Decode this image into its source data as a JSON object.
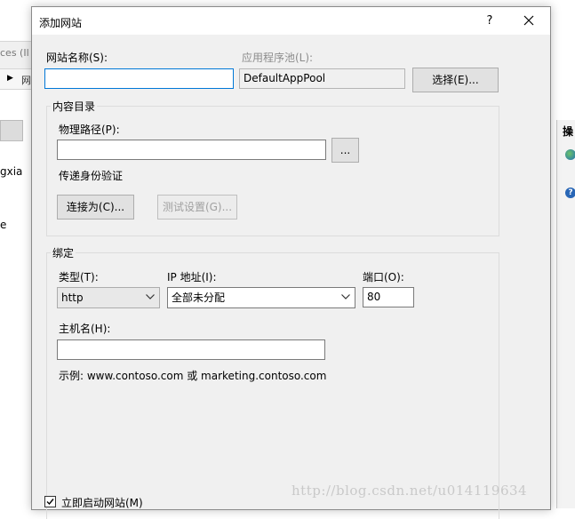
{
  "background": {
    "address_fragment": "ces (Il",
    "nav_fragment": "网",
    "tree_item_fragment": "gxia",
    "tree_mark": "e",
    "actions_header_fragment": "操"
  },
  "dialog": {
    "title": "添加网站",
    "help_label": "?",
    "site_name": {
      "label": "网站名称(S):",
      "value": ""
    },
    "app_pool": {
      "label": "应用程序池(L):",
      "value": "DefaultAppPool",
      "select_button": "选择(E)..."
    },
    "content_dir": {
      "group_title": "内容目录",
      "physical_path": {
        "label": "物理路径(P):",
        "value": "",
        "browse_button": "..."
      },
      "auth_label": "传递身份验证",
      "connect_as_button": "连接为(C)...",
      "test_settings_button": "测试设置(G)..."
    },
    "binding": {
      "group_title": "绑定",
      "type": {
        "label": "类型(T):",
        "selected": "http"
      },
      "ip": {
        "label": "IP 地址(I):",
        "selected": "全部未分配"
      },
      "port": {
        "label": "端口(O):",
        "value": "80"
      },
      "host": {
        "label": "主机名(H):",
        "value": ""
      },
      "example": "示例: www.contoso.com 或 marketing.contoso.com"
    },
    "start_immediately": {
      "label": "立即启动网站(M)",
      "checked": true
    }
  },
  "watermark": "http://blog.csdn.net/u014119634"
}
